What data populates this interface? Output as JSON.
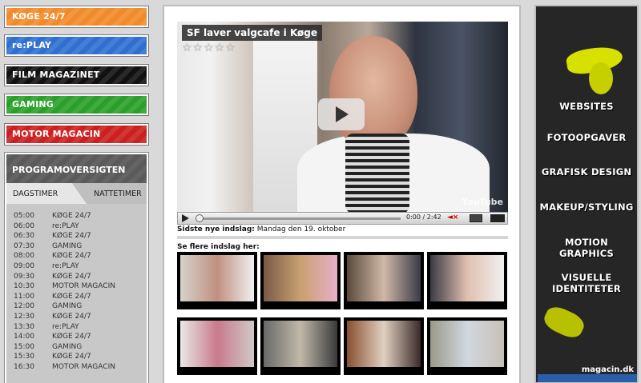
{
  "nav": [
    {
      "label": "KØGE 24/7",
      "color": "#f08a2a"
    },
    {
      "label": "re:PLAY",
      "color": "#2f6fd0"
    },
    {
      "label": "FILM MAGAZINET",
      "color": "#111111"
    },
    {
      "label": "GAMING",
      "color": "#2aa02a"
    },
    {
      "label": "MOTOR MAGACIN",
      "color": "#cc1f1f"
    }
  ],
  "schedule": {
    "title": "PROGRAMOVERSIGTEN",
    "tabs": [
      "DAGSTIMER",
      "NATTETIMER"
    ],
    "rows": [
      {
        "time": "05:00",
        "name": "KØGE 24/7"
      },
      {
        "time": "06:00",
        "name": "re:PLAY"
      },
      {
        "time": "06:30",
        "name": "KØGE 24/7"
      },
      {
        "time": "07:30",
        "name": "GAMING"
      },
      {
        "time": "08:00",
        "name": "KØGE 24/7"
      },
      {
        "time": "09:00",
        "name": "re:PLAY"
      },
      {
        "time": "09:30",
        "name": "KØGE 24/7"
      },
      {
        "time": "10:30",
        "name": "MOTOR MAGACIN"
      },
      {
        "time": "11:00",
        "name": "KØGE 24/7"
      },
      {
        "time": "12:00",
        "name": "GAMING"
      },
      {
        "time": "12:30",
        "name": "KØGE 24/7"
      },
      {
        "time": "13:30",
        "name": "re:PLAY"
      },
      {
        "time": "14:00",
        "name": "KØGE 24/7"
      },
      {
        "time": "15:00",
        "name": "GAMING"
      },
      {
        "time": "15:30",
        "name": "KØGE 24/7"
      },
      {
        "time": "16:30",
        "name": "MOTOR MAGACIN"
      }
    ]
  },
  "video": {
    "title": "SF laver valgcafe i Køge",
    "stars": "☆☆☆☆☆",
    "time": "0:00 / 2:42",
    "watermark": "YouTube",
    "latest_label": "Sidste nye indslag:",
    "latest_value": "Mandag den 19. oktober",
    "more_label": "Se flere indslag her:"
  },
  "thumbs": [
    {
      "colors": [
        "#d6d2cc",
        "#c09080",
        "#f0f0f0"
      ]
    },
    {
      "colors": [
        "#7a5a48",
        "#c8a070",
        "#e8b0c8"
      ]
    },
    {
      "colors": [
        "#5a4a3a",
        "#d0b8a8",
        "#3a3a48"
      ]
    },
    {
      "colors": [
        "#3a3a44",
        "#e0c0b0",
        "#f0f0f0"
      ]
    },
    {
      "colors": [
        "#e8e8e8",
        "#c87a8a",
        "#d0c8c8"
      ]
    },
    {
      "colors": [
        "#6a6a6a",
        "#c0b8a8",
        "#3a3a3a"
      ]
    },
    {
      "colors": [
        "#8a5030",
        "#e0d0c0",
        "#3a2a28"
      ]
    },
    {
      "colors": [
        "#9a9a8a",
        "#d0d8e0",
        "#c8c0b8"
      ]
    }
  ],
  "right_menu": [
    "WEBSITES",
    "FOTOOPGAVER",
    "GRAFISK DESIGN",
    "MAKEUP/STYLING",
    "MOTION GRAPHICS",
    "VISUELLE IDENTITETER"
  ],
  "brand": "magacin.dk"
}
